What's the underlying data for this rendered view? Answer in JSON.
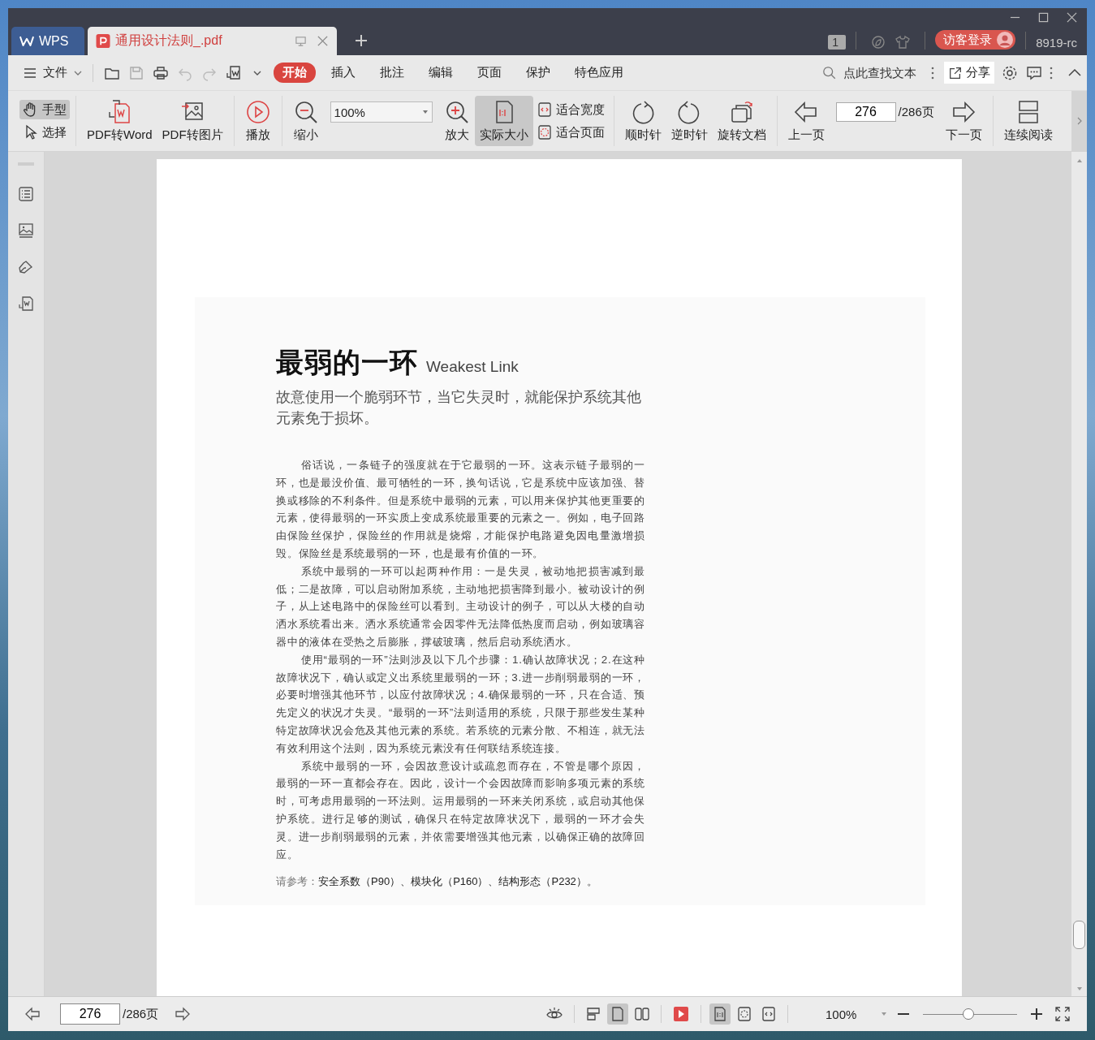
{
  "tabs": [
    {
      "label": "WPS",
      "kind": "home",
      "selected": false
    },
    {
      "label": "通用设计法则_.pdf",
      "kind": "pdf",
      "selected": true
    }
  ],
  "title_bar": {
    "page_badge": "1",
    "login_button": "访客登录",
    "user_name": "8919-rc"
  },
  "menu": {
    "file": "文件",
    "tabs": [
      {
        "label": "开始",
        "selected": true
      },
      {
        "label": "插入",
        "selected": false
      },
      {
        "label": "批注",
        "selected": false
      },
      {
        "label": "编辑",
        "selected": false
      },
      {
        "label": "页面",
        "selected": false
      },
      {
        "label": "保护",
        "selected": false
      },
      {
        "label": "特色应用",
        "selected": false
      }
    ],
    "search_placeholder": "点此查找文本",
    "share": "分享"
  },
  "toolbar": {
    "modes": [
      {
        "label": "手型",
        "kind": "hand",
        "selected": true
      },
      {
        "label": "选择",
        "kind": "select",
        "selected": false
      }
    ],
    "convert": [
      {
        "label": "PDF转Word",
        "kind": "pdf-word"
      },
      {
        "label": "PDF转图片",
        "kind": "pdf-image"
      },
      {
        "label": "播放",
        "kind": "play"
      }
    ],
    "zoom_out": "缩小",
    "zoom_value": "100%",
    "zoom_in": "放大",
    "actual_size": {
      "label": "实际大小",
      "selected": true
    },
    "fit": [
      {
        "label": "适合宽度",
        "kind": "width"
      },
      {
        "label": "适合页面",
        "kind": "page"
      }
    ],
    "rotate": [
      {
        "label": "顺时针",
        "kind": "cw"
      },
      {
        "label": "逆时针",
        "kind": "ccw"
      },
      {
        "label": "旋转文档",
        "kind": "doc"
      }
    ],
    "prev": "上一页",
    "page": "276",
    "total": "/286页",
    "next": "下一页",
    "continuous": "连续阅读"
  },
  "document": {
    "title": "最弱的一环",
    "title_en": "Weakest Link",
    "subtitle": "故意使用一个脆弱环节，当它失灵时，就能保护系统其他元素免于损坏。",
    "paragraphs": [
      "俗话说，一条链子的强度就在于它最弱的一环。这表示链子最弱的一环，也是最没价值、最可牺牲的一环，换句话说，它是系统中应该加强、替换或移除的不利条件。但是系统中最弱的元素，可以用来保护其他更重要的元素，使得最弱的一环实质上变成系统最重要的元素之一。例如，电子回路由保险丝保护，保险丝的作用就是烧熔，才能保护电路避免因电量激增损毁。保险丝是系统最弱的一环，也是最有价值的一环。",
      "系统中最弱的一环可以起两种作用：一是失灵，被动地把损害减到最低；二是故障，可以启动附加系统，主动地把损害降到最小。被动设计的例子，从上述电路中的保险丝可以看到。主动设计的例子，可以从大楼的自动洒水系统看出来。洒水系统通常会因零件无法降低热度而启动，例如玻璃容器中的液体在受热之后膨胀，撑破玻璃，然后启动系统洒水。",
      "使用“最弱的一环”法则涉及以下几个步骤：1.确认故障状况；2.在这种故障状况下，确认或定义出系统里最弱的一环；3.进一步削弱最弱的一环，必要时增强其他环节，以应付故障状况；4.确保最弱的一环，只在合适、预先定义的状况才失灵。“最弱的一环”法则适用的系统，只限于那些发生某种特定故障状况会危及其他元素的系统。若系统的元素分散、不相连，就无法有效利用这个法则，因为系统元素没有任何联结系统连接。",
      "系统中最弱的一环，会因故意设计或疏忽而存在，不管是哪个原因，最弱的一环一直都会存在。因此，设计一个会因故障而影响多项元素的系统时，可考虑用最弱的一环法则。运用最弱的一环来关闭系统，或启动其他保护系统。进行足够的测试，确保只在特定故障状况下，最弱的一环才会失灵。进一步削弱最弱的元素，并依需要增强其他元素，以确保正确的故障回应。"
    ],
    "see_also_label": "请参考：",
    "see_also": "安全系数（P90）、模块化（P160）、结构形态（P232）。"
  },
  "status_bar": {
    "page": "276",
    "total": "/286页",
    "views": [
      {
        "kind": "double",
        "selected": false
      },
      {
        "kind": "single",
        "selected": true
      },
      {
        "kind": "book",
        "selected": false
      }
    ],
    "fits": [
      {
        "kind": "actual",
        "selected": true
      },
      {
        "kind": "page",
        "selected": false
      },
      {
        "kind": "width",
        "selected": false
      }
    ],
    "zoom": "100%",
    "zoom_slider": {
      "level": 0.48
    }
  }
}
